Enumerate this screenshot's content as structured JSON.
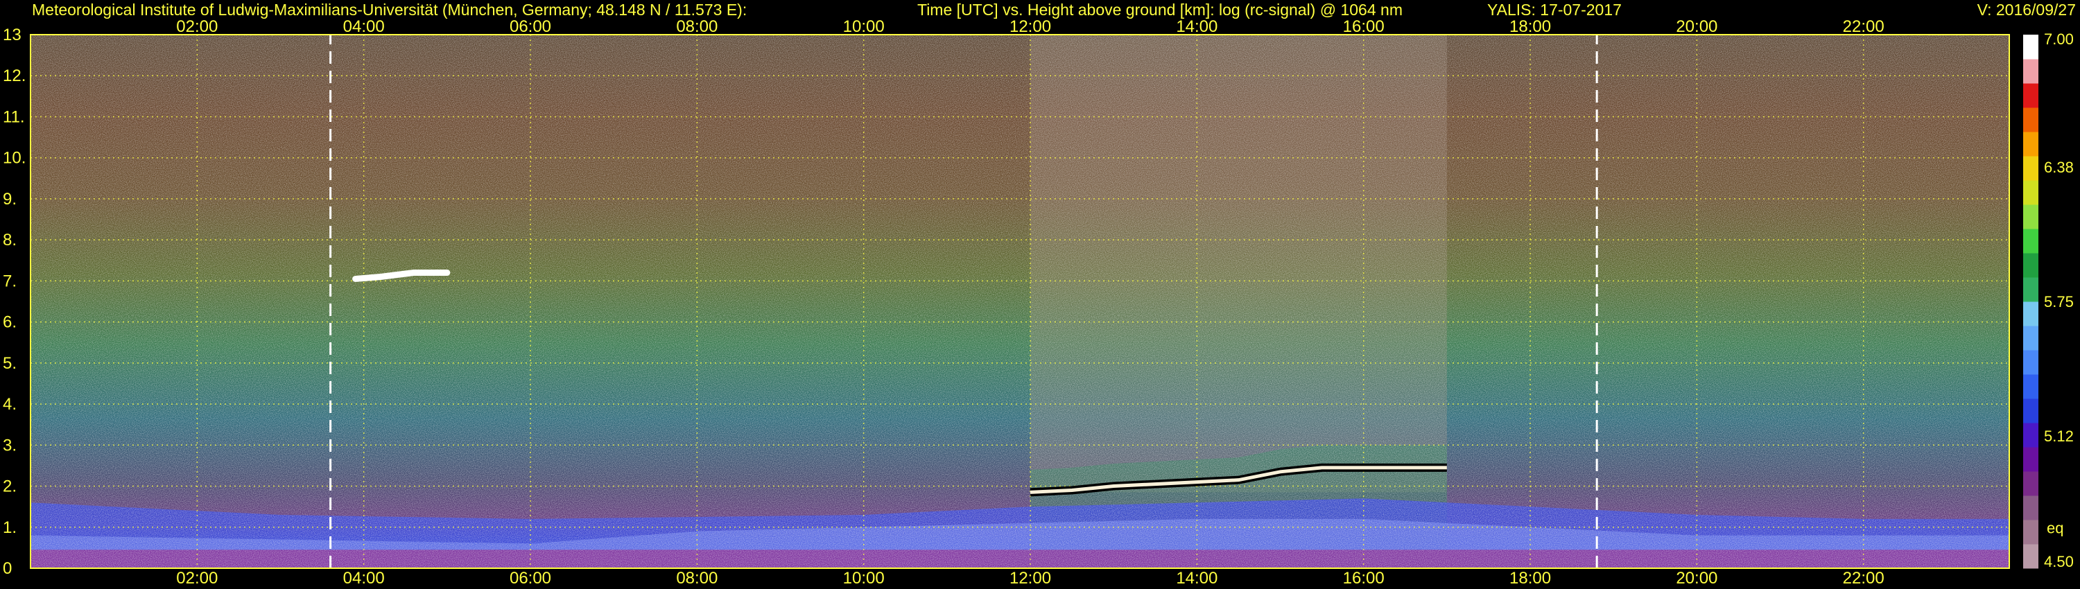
{
  "header": {
    "institute": "Meteorological Institute of Ludwig-Maximilians-Universität (München, Germany; 48.148 N / 11.573 E):",
    "plot_title": "Time [UTC] vs. Height above ground [km]: log (rc-signal) @ 1064 nm",
    "instrument_date": "YALIS: 17-07-2017",
    "version": "V: 2016/09/27"
  },
  "chart_data": {
    "type": "heatmap",
    "title": "Time [UTC] vs. Height above ground [km]: log (rc-signal) @ 1064 nm",
    "xlabel": "",
    "ylabel": "",
    "x_range_hours": [
      0.0,
      23.75
    ],
    "x_ticks": [
      "02:00",
      "04:00",
      "06:00",
      "08:00",
      "10:00",
      "12:00",
      "14:00",
      "16:00",
      "18:00",
      "20:00",
      "22:00"
    ],
    "x_tick_hours": [
      2,
      4,
      6,
      8,
      10,
      12,
      14,
      16,
      18,
      20,
      22
    ],
    "ylim": [
      0,
      13
    ],
    "y_ticks": [
      "0",
      "1.",
      "2.",
      "3.",
      "4.",
      "5.",
      "6.",
      "7.",
      "8.",
      "9.",
      "10.",
      "11.",
      "12.",
      "13"
    ],
    "y_tick_values": [
      0,
      1,
      2,
      3,
      4,
      5,
      6,
      7,
      8,
      9,
      10,
      11,
      12,
      13
    ],
    "grid": true,
    "colorbar": {
      "min": 4.5,
      "max": 7.0,
      "tick_labels": [
        "7.00",
        "6.38",
        "5.75",
        "5.12",
        "4.50"
      ],
      "tick_values": [
        7.0,
        6.38,
        5.75,
        5.12,
        4.5
      ],
      "extra_label": "eq",
      "colors": [
        "#b99aa8",
        "#a07890",
        "#8a5a88",
        "#7a2a8a",
        "#6a10a0",
        "#4a18c8",
        "#2840e0",
        "#3060f0",
        "#4a88f8",
        "#60a8f8",
        "#78c8f0",
        "#30b060",
        "#20a040",
        "#40d040",
        "#90e040",
        "#d0e020",
        "#f0d010",
        "#f8a000",
        "#f06000",
        "#e01818",
        "#f0a0a8",
        "#ffffff"
      ]
    },
    "series": [
      {
        "values": [
          [
            3.6,
            0.0
          ],
          [
            3.6,
            13.0
          ],
          [
            18.8,
            0.0
          ],
          [
            18.8,
            13.0
          ]
        ]
      },
      {
        "values": [
          [
            12.0,
            1.85
          ],
          [
            12.5,
            1.9
          ],
          [
            13.0,
            2.0
          ],
          [
            13.5,
            2.05
          ],
          [
            14.0,
            2.1
          ],
          [
            14.5,
            2.15
          ],
          [
            15.0,
            2.35
          ],
          [
            15.5,
            2.45
          ],
          [
            16.0,
            2.45
          ],
          [
            16.5,
            2.45
          ],
          [
            17.0,
            2.45
          ]
        ]
      },
      {
        "values": [
          [
            3.9,
            7.05
          ],
          [
            4.2,
            7.1
          ],
          [
            4.6,
            7.2
          ],
          [
            5.0,
            7.2
          ]
        ]
      }
    ],
    "colors": {
      "axis_text": "#ffff40",
      "grid": "#ffff40",
      "background": "#000000"
    }
  }
}
